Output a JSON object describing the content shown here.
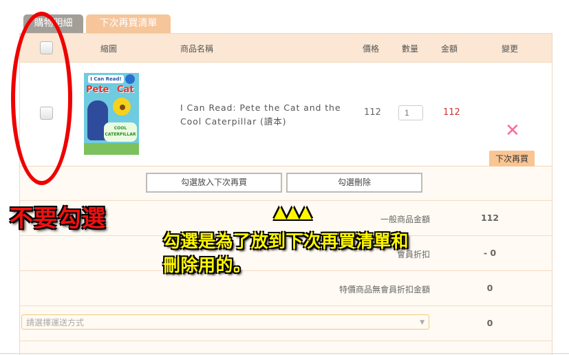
{
  "tabs": [
    "購物明細",
    "下次再買清單"
  ],
  "header": {
    "thumbnail": "縮圖",
    "name": "商品名稱",
    "price": "價格",
    "quantity": "數量",
    "amount": "金額",
    "change": "變更"
  },
  "product": {
    "name": "I Can Read: Pete the Cat and the Cool Caterpillar (讀本)",
    "price": "112",
    "quantity_placeholder": "1",
    "amount": "112",
    "delete_icon": "close-icon",
    "next_label": "下次再買",
    "cover": {
      "series": "I Can Read!",
      "title_left": "Pete",
      "title_right": "Cat",
      "subtitle": "COOL CATERPILLAR"
    }
  },
  "actions": {
    "move_to_later": "勾選放入下次再買",
    "delete_selected": "勾選刪除"
  },
  "summary": [
    {
      "label": "一般商品金額",
      "value": "112"
    },
    {
      "label": "會員折扣",
      "value": "- 0"
    },
    {
      "label": "特價商品無會員折扣金額",
      "value": "0"
    }
  ],
  "shipping": {
    "placeholder": "請選擇運送方式",
    "value": "0"
  },
  "annotations": {
    "no_check": "不要勾選",
    "explain_line1": "勾選是為了放到下次再買清單和",
    "explain_line2": "刪除用的。",
    "arrows": "▲▲▲"
  },
  "colors": {
    "accent": "#f6c59a",
    "header_bg": "#fbe7d3",
    "price_red": "#cc3333",
    "annotation_red": "#ee1111",
    "annotation_yellow": "#fff700"
  }
}
